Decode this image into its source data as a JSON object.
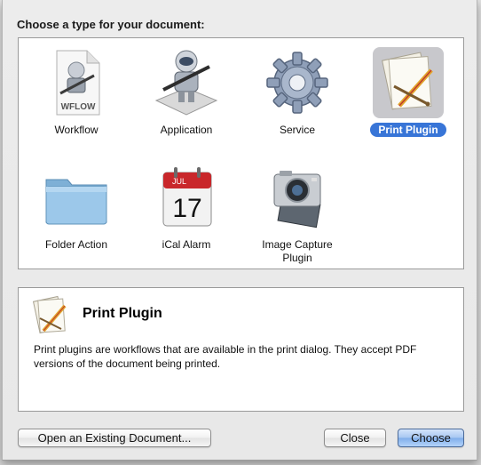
{
  "dialog": {
    "heading": "Choose a type for your document:",
    "types": [
      {
        "label": "Workflow",
        "icon": "workflow-document-icon",
        "selected": false
      },
      {
        "label": "Application",
        "icon": "automator-robot-icon",
        "selected": false
      },
      {
        "label": "Service",
        "icon": "gear-icon",
        "selected": false
      },
      {
        "label": "Print Plugin",
        "icon": "print-plugin-icon",
        "selected": true
      },
      {
        "label": "Folder Action",
        "icon": "folder-icon",
        "selected": false
      },
      {
        "label": "iCal Alarm",
        "icon": "calendar-icon",
        "selected": false
      },
      {
        "label": "Image Capture Plugin",
        "icon": "camera-icon",
        "selected": false
      }
    ],
    "calendar_month": "JUL",
    "calendar_day": "17",
    "workflow_file_label": "WFLOW",
    "description": {
      "title": "Print Plugin",
      "text": "Print plugins are workflows that are available in the print dialog. They accept PDF versions of the document being printed."
    },
    "buttons": {
      "open_existing": "Open an Existing Document...",
      "close": "Close",
      "choose": "Choose"
    }
  },
  "colors": {
    "selection": "#3875d7",
    "default_button": "#80aeea"
  }
}
